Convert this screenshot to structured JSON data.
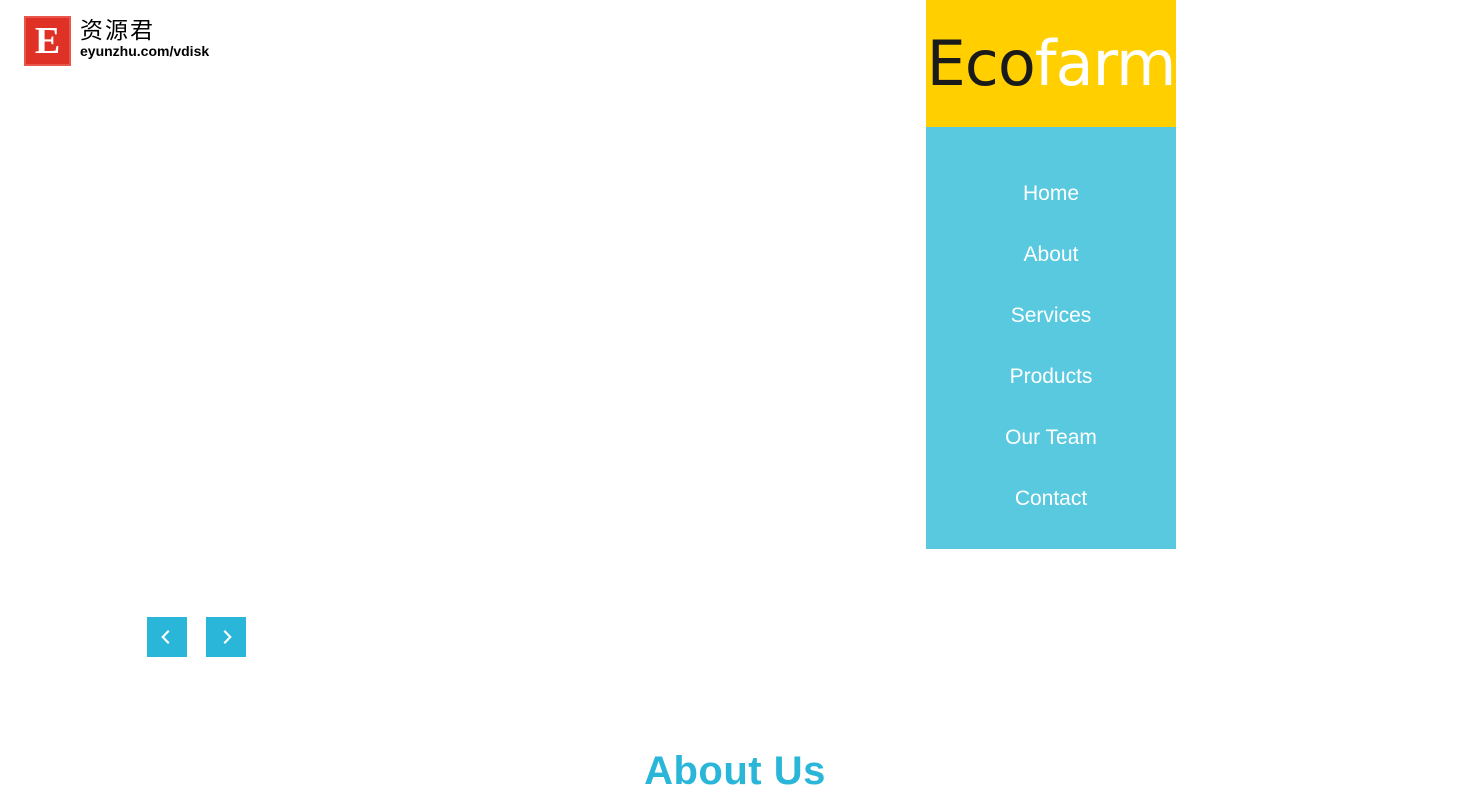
{
  "watermark": {
    "badge_letter": "E",
    "cn_name": "资源君",
    "url": "eyunzhu.com/vdisk",
    "badge_color": "#e03127"
  },
  "brand": {
    "name_dark": "Eco",
    "name_light": "farm",
    "background": "#ffcf00",
    "dark_color": "#1a1a1a",
    "light_color": "#ffffff"
  },
  "nav": {
    "background": "#59c9df",
    "link_color": "#ffffff",
    "items": [
      {
        "label": "Home"
      },
      {
        "label": "About"
      },
      {
        "label": "Services"
      },
      {
        "label": "Products"
      },
      {
        "label": "Our Team"
      },
      {
        "label": "Contact"
      }
    ]
  },
  "carousel": {
    "accent": "#29b6d8",
    "prev": {
      "icon": "chevron-left-icon",
      "glyph": "‹"
    },
    "next": {
      "icon": "chevron-right-icon",
      "glyph": "›"
    }
  },
  "about_section": {
    "title": "About Us",
    "title_color": "#29b6d8"
  }
}
